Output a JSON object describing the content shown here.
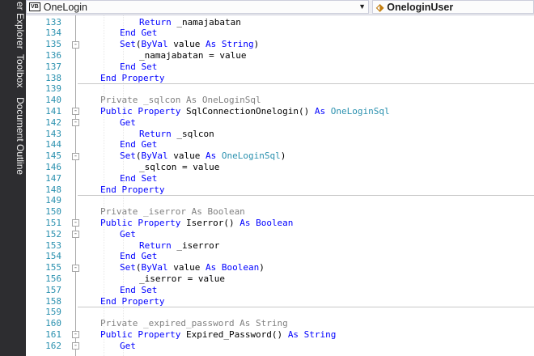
{
  "sidebar": {
    "tabs": [
      "er Explorer",
      "Toolbox",
      "Document Outline"
    ]
  },
  "navbar": {
    "left_icon": "VB",
    "left_value": "OneLogin",
    "right_value": "OneloginUser"
  },
  "editor": {
    "lines": [
      {
        "n": "133",
        "indent": 4,
        "tokens": [
          [
            "kw",
            "Return "
          ],
          [
            "t",
            "_namajabatan"
          ]
        ]
      },
      {
        "n": "134",
        "indent": 3,
        "tokens": [
          [
            "kw",
            "End Get"
          ]
        ]
      },
      {
        "n": "135",
        "indent": 3,
        "tokens": [
          [
            "kw",
            "Set"
          ],
          [
            "t",
            "("
          ],
          [
            "kw",
            "ByVal "
          ],
          [
            "t",
            "value "
          ],
          [
            "kw",
            "As String"
          ],
          [
            "t",
            ")"
          ]
        ]
      },
      {
        "n": "136",
        "indent": 4,
        "tokens": [
          [
            "t",
            "_namajabatan = value"
          ]
        ]
      },
      {
        "n": "137",
        "indent": 3,
        "tokens": [
          [
            "kw",
            "End Set"
          ]
        ]
      },
      {
        "n": "138",
        "indent": 2,
        "tokens": [
          [
            "kw",
            "End Property"
          ]
        ]
      },
      {
        "n": "139",
        "indent": 0,
        "tokens": []
      },
      {
        "n": "140",
        "indent": 2,
        "tokens": [
          [
            "g",
            "Private _sqlcon As OneLoginSql"
          ]
        ]
      },
      {
        "n": "141",
        "indent": 2,
        "tokens": [
          [
            "kw",
            "Public Property "
          ],
          [
            "t",
            "SqlConnectionOnelogin() "
          ],
          [
            "kw",
            "As "
          ],
          [
            "ty",
            "OneLoginSql"
          ]
        ]
      },
      {
        "n": "142",
        "indent": 3,
        "tokens": [
          [
            "kw",
            "Get"
          ]
        ]
      },
      {
        "n": "143",
        "indent": 4,
        "tokens": [
          [
            "kw",
            "Return "
          ],
          [
            "t",
            "_sqlcon"
          ]
        ]
      },
      {
        "n": "144",
        "indent": 3,
        "tokens": [
          [
            "kw",
            "End Get"
          ]
        ]
      },
      {
        "n": "145",
        "indent": 3,
        "tokens": [
          [
            "kw",
            "Set"
          ],
          [
            "t",
            "("
          ],
          [
            "kw",
            "ByVal "
          ],
          [
            "t",
            "value "
          ],
          [
            "kw",
            "As "
          ],
          [
            "ty",
            "OneLoginSql"
          ],
          [
            "t",
            ")"
          ]
        ]
      },
      {
        "n": "146",
        "indent": 4,
        "tokens": [
          [
            "t",
            "_sqlcon = value"
          ]
        ]
      },
      {
        "n": "147",
        "indent": 3,
        "tokens": [
          [
            "kw",
            "End Set"
          ]
        ]
      },
      {
        "n": "148",
        "indent": 2,
        "tokens": [
          [
            "kw",
            "End Property"
          ]
        ]
      },
      {
        "n": "149",
        "indent": 0,
        "tokens": []
      },
      {
        "n": "150",
        "indent": 2,
        "tokens": [
          [
            "g",
            "Private _iserror As Boolean"
          ]
        ]
      },
      {
        "n": "151",
        "indent": 2,
        "tokens": [
          [
            "kw",
            "Public Property "
          ],
          [
            "t",
            "Iserror() "
          ],
          [
            "kw",
            "As Boolean"
          ]
        ]
      },
      {
        "n": "152",
        "indent": 3,
        "tokens": [
          [
            "kw",
            "Get"
          ]
        ]
      },
      {
        "n": "153",
        "indent": 4,
        "tokens": [
          [
            "kw",
            "Return "
          ],
          [
            "t",
            "_iserror"
          ]
        ]
      },
      {
        "n": "154",
        "indent": 3,
        "tokens": [
          [
            "kw",
            "End Get"
          ]
        ]
      },
      {
        "n": "155",
        "indent": 3,
        "tokens": [
          [
            "kw",
            "Set"
          ],
          [
            "t",
            "("
          ],
          [
            "kw",
            "ByVal "
          ],
          [
            "t",
            "value "
          ],
          [
            "kw",
            "As Boolean"
          ],
          [
            "t",
            ")"
          ]
        ]
      },
      {
        "n": "156",
        "indent": 4,
        "tokens": [
          [
            "t",
            "_iserror = value"
          ]
        ]
      },
      {
        "n": "157",
        "indent": 3,
        "tokens": [
          [
            "kw",
            "End Set"
          ]
        ]
      },
      {
        "n": "158",
        "indent": 2,
        "tokens": [
          [
            "kw",
            "End Property"
          ]
        ]
      },
      {
        "n": "159",
        "indent": 0,
        "tokens": []
      },
      {
        "n": "160",
        "indent": 2,
        "tokens": [
          [
            "g",
            "Private _expired_password As String"
          ]
        ]
      },
      {
        "n": "161",
        "indent": 2,
        "tokens": [
          [
            "kw",
            "Public Property "
          ],
          [
            "t",
            "Expired_Password() "
          ],
          [
            "kw",
            "As String"
          ]
        ]
      },
      {
        "n": "162",
        "indent": 3,
        "tokens": [
          [
            "kw",
            "Get"
          ]
        ]
      }
    ]
  }
}
